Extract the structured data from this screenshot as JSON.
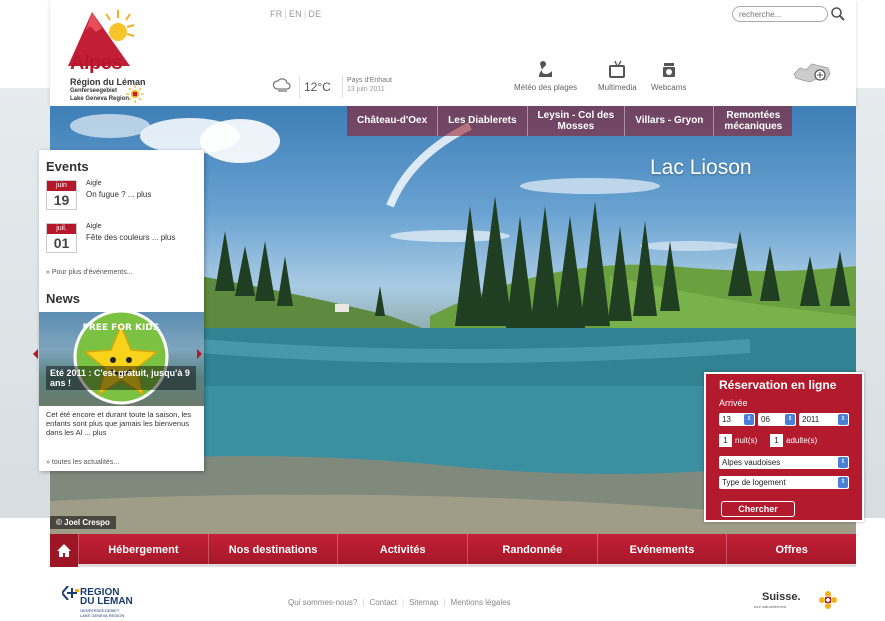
{
  "header": {
    "languages": [
      "FR",
      "EN",
      "DE"
    ],
    "search_placeholder": "recherche...",
    "logo": {
      "title": "Alpes",
      "line1": "Région du Léman",
      "line2": "Genferseegebiet",
      "line3": "Lake Geneva Region"
    },
    "weather": {
      "temperature": "12°C",
      "place": "Pays d'Enhaut",
      "date": "13 juin 2011"
    },
    "tools": [
      {
        "label": "Météo des plages",
        "icon": "beach-weather-icon"
      },
      {
        "label": "Multimedia",
        "icon": "tv-icon"
      },
      {
        "label": "Webcams",
        "icon": "webcam-icon"
      }
    ]
  },
  "hero": {
    "title": "Lac Lioson",
    "photo_credit": "© Joel Crespo"
  },
  "subnav": [
    {
      "line1": "Château-d'Oex",
      "line2": ""
    },
    {
      "line1": "Les Diablerets",
      "line2": ""
    },
    {
      "line1": "Leysin - Col des",
      "line2": "Mosses"
    },
    {
      "line1": "Villars - Gryon",
      "line2": ""
    },
    {
      "line1": "Remontées",
      "line2": "mécaniques"
    }
  ],
  "events": {
    "heading": "Events",
    "items": [
      {
        "month": "juin",
        "day": "19",
        "place": "Aigle",
        "title": "On fugue ? ... plus"
      },
      {
        "month": "juil.",
        "day": "01",
        "place": "Aigle",
        "title": "Fête des couleurs ... plus"
      }
    ],
    "more_link": "» Pour plus d'événements..."
  },
  "news": {
    "heading": "News",
    "badge_text": "FREE FOR KIDS",
    "headline": "Eté 2011 : C'est gratuit, jusqu'à 9 ans !",
    "body": "Cet été encore et durant toute la saison, les enfants sont plus que jamais les bienvenus dans les Al ... plus",
    "more_link": "» toutes les actualités..."
  },
  "booking": {
    "title": "Réservation en ligne",
    "arrival_label": "Arrivée",
    "day": "13",
    "month": "06",
    "year": "2011",
    "nights_value": "1",
    "nights_label": "nuit(s)",
    "adults_value": "1",
    "adults_label": "adulte(s)",
    "region": "Alpes vaudoises",
    "lodging_type": "Type de logement",
    "submit": "Chercher"
  },
  "mainnav": [
    "Hébergement",
    "Nos destinations",
    "Activités",
    "Randonnée",
    "Evénements",
    "Offres"
  ],
  "footer": {
    "region_logo_title_1": "REGION",
    "region_logo_title_2": "DU LEMAN",
    "region_logo_sub_1": "GENFERSEEGEBIET",
    "region_logo_sub_2": "LAKE GENEVA REGION",
    "links": [
      "Qui sommes-nous?",
      "Contact",
      "Sitemap",
      "Mentions légales"
    ],
    "suisse_title": "Suisse.",
    "suisse_sub": "tout naturellement."
  },
  "colors": {
    "brand_red": "#b5182b",
    "nav_red": "#c42034",
    "booking_bg": "#b31a2d"
  }
}
